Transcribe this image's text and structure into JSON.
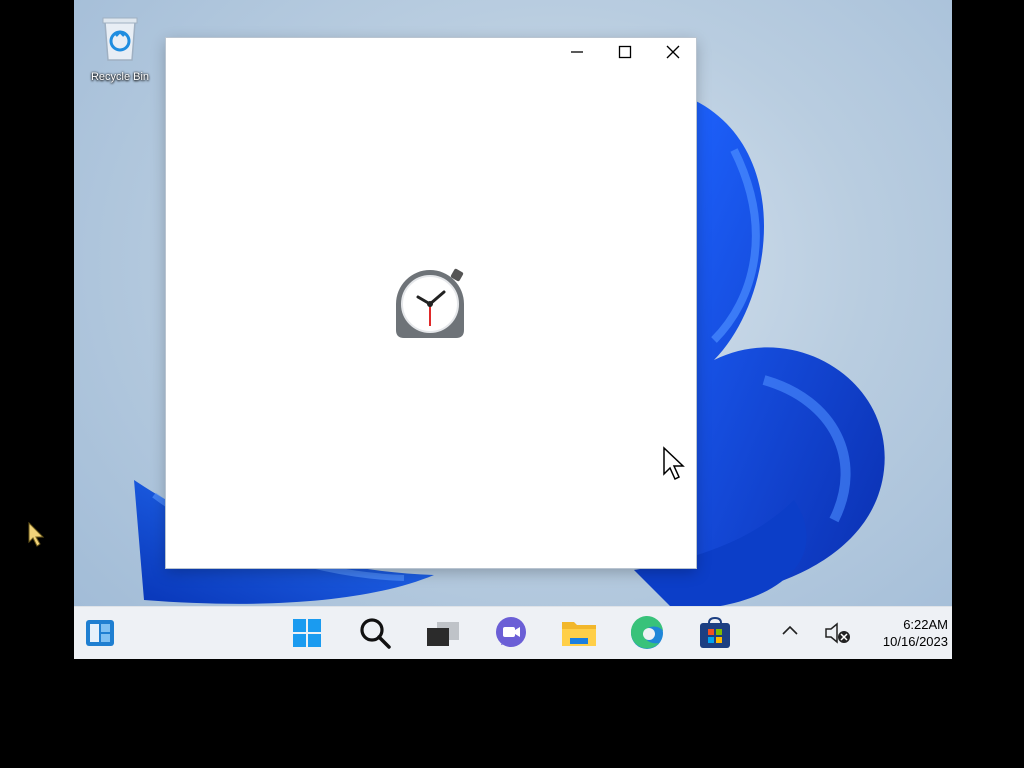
{
  "desktop": {
    "recycle_bin_label": "Recycle Bin"
  },
  "app_window": {
    "buttons": {
      "minimize": "minimize-icon",
      "maximize": "maximize-icon",
      "close": "close-icon"
    },
    "splash_icon": "alarm-clock-icon"
  },
  "taskbar": {
    "apps": [
      "widgets-icon",
      "start-icon",
      "search-icon",
      "task-view-icon",
      "chat-icon",
      "file-explorer-icon",
      "edge-icon",
      "store-icon"
    ],
    "tray": {
      "time": "6:22AM",
      "date": "10/16/2023"
    }
  },
  "colors": {
    "accent": "#0a5bd6",
    "taskbar_bg": "#eef1f5"
  }
}
